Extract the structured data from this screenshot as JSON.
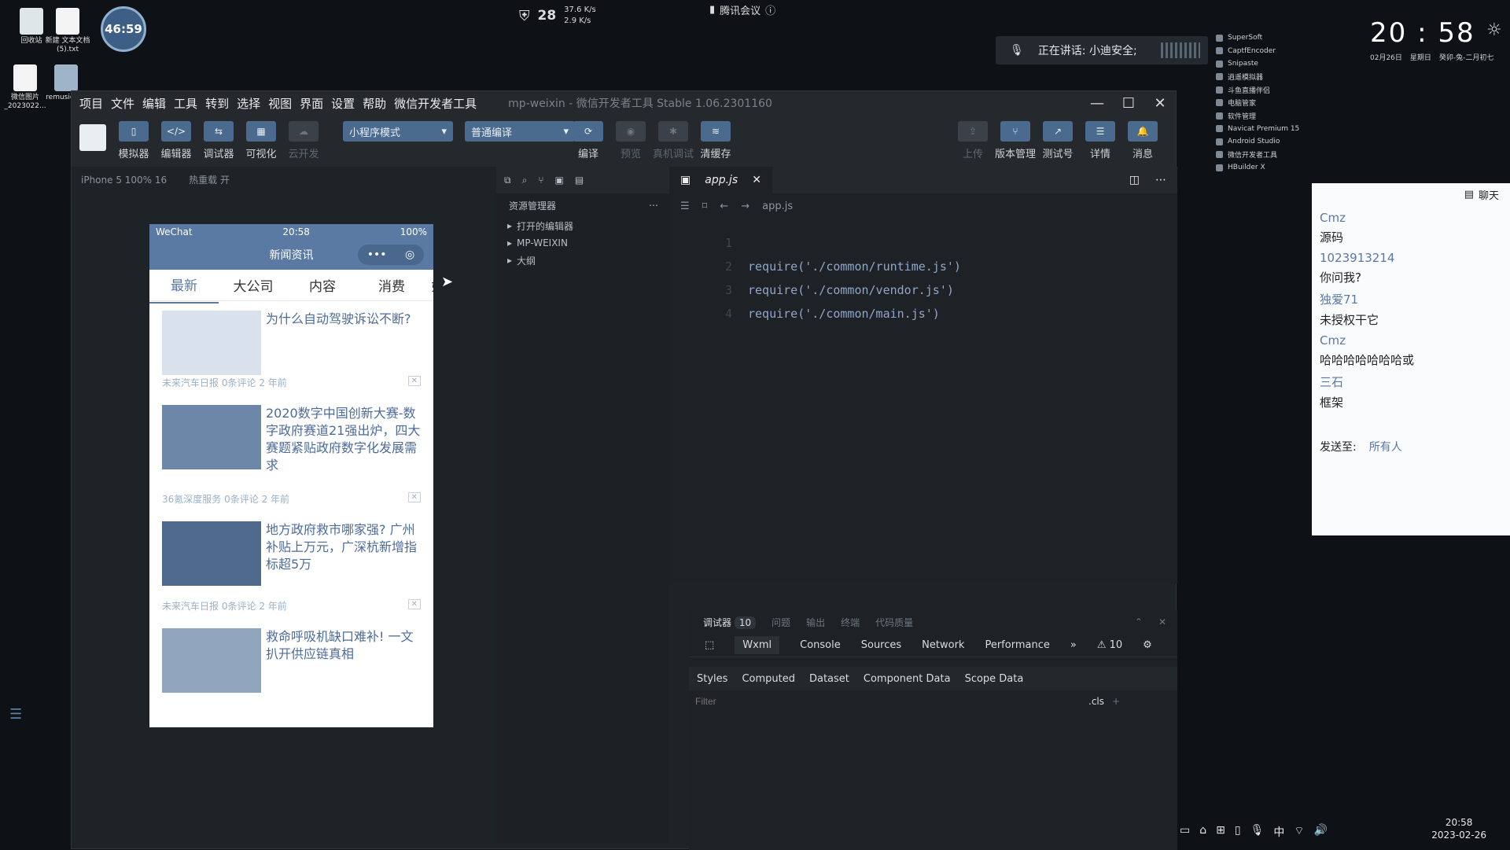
{
  "desktop": {
    "icons": [
      {
        "label": "回收站"
      },
      {
        "label": "新建 文本文档 (5).txt"
      },
      {
        "label": "微信图片_2023022..."
      },
      {
        "label": "remusic-ter"
      }
    ],
    "timer": "46:59",
    "security_score": "28",
    "net_up": "37.6 K/s",
    "net_down": "2.9 K/s",
    "meeting_app": "腾讯会议",
    "speaking": "正在讲话: 小迪安全;"
  },
  "widget": {
    "apps": [
      "SuperSoft",
      "CaptfEncoder",
      "Snipaste",
      "逍遥模拟器",
      "斗鱼直播伴侣",
      "电脑管家",
      "软件管理",
      "Navicat Premium 15",
      "Android Studio",
      "微信开发者工具",
      "HBuilder X"
    ],
    "clock": "20 : 58",
    "date": "02月26日",
    "weekday": "星期日",
    "lunar": "癸卯-兔-二月初七"
  },
  "chat": {
    "header": "聊天",
    "messages": [
      {
        "name": "Cmz",
        "text": "源码"
      },
      {
        "name": "1023913214",
        "text": "你问我?"
      },
      {
        "name": "独爱71",
        "text": "未授权干它"
      },
      {
        "name": "Cmz",
        "text": "哈哈哈哈哈哈哈或"
      },
      {
        "name": "三石",
        "text": "框架"
      }
    ],
    "send_to_label": "发送至:",
    "send_to_value": "所有人"
  },
  "ide": {
    "menu": [
      "项目",
      "文件",
      "编辑",
      "工具",
      "转到",
      "选择",
      "视图",
      "界面",
      "设置",
      "帮助",
      "微信开发者工具"
    ],
    "title": "mp-weixin - 微信开发者工具 Stable 1.06.2301160",
    "toolbar": {
      "simulator": "模拟器",
      "editor": "编辑器",
      "debugger": "调试器",
      "visual": "可视化",
      "cloud": "云开发",
      "mode": "小程序模式",
      "compile_mode": "普通编译",
      "compile": "编译",
      "preview": "预览",
      "real_debug": "真机调试",
      "clear_cache": "清缓存",
      "upload": "上传",
      "version": "版本管理",
      "test": "测试号",
      "details": "详情",
      "messages": "消息"
    },
    "device": "iPhone 5 100% 16",
    "hot_reload": "热重载 开",
    "phone": {
      "carrier": "WeChat",
      "time": "20:58",
      "battery": "100%",
      "nav_title": "新闻资讯",
      "tabs": [
        "最新",
        "大公司",
        "内容",
        "消费",
        "娱"
      ],
      "news": [
        {
          "title": "为什么自动驾驶诉讼不断?",
          "source": "未来汽车日报",
          "comments": "0条评论",
          "time": "2 年前"
        },
        {
          "title": "2020数字中国创新大赛-数字政府赛道21强出炉，四大赛题紧贴政府数字化发展需求",
          "source": "36氪深度服务",
          "comments": "0条评论",
          "time": "2 年前"
        },
        {
          "title": "地方政府救市哪家强? 广州补贴上万元，广深杭新增指标超5万",
          "source": "未来汽车日报",
          "comments": "0条评论",
          "time": "2 年前"
        },
        {
          "title": "救命呼吸机缺口难补! 一文扒开供应链真相",
          "source": "",
          "comments": "",
          "time": ""
        }
      ]
    },
    "explorer": {
      "title": "资源管理器",
      "sections": [
        "打开的编辑器",
        "MP-WEIXIN",
        "大纲"
      ]
    },
    "editor": {
      "tab": "app.js",
      "breadcrumb": "app.js",
      "lines": [
        {
          "n": "1",
          "code": ""
        },
        {
          "n": "2",
          "code": "require('./common/runtime.js')"
        },
        {
          "n": "3",
          "code": "require('./common/vendor.js')"
        },
        {
          "n": "4",
          "code": "require('./common/main.js')"
        }
      ]
    },
    "debug": {
      "top_tabs": [
        "调试器",
        "问题",
        "输出",
        "终端",
        "代码质量"
      ],
      "debugger_count": "10",
      "tabs": [
        "Wxml",
        "Console",
        "Sources",
        "Network",
        "Performance"
      ],
      "warn_count": "10",
      "style_tabs": [
        "Styles",
        "Computed",
        "Dataset",
        "Component Data",
        "Scope Data"
      ],
      "filter_placeholder": "Filter",
      "cls": ".cls"
    }
  },
  "taskbar": {
    "ime": "中",
    "time": "20:58",
    "date": "2023-02-26"
  }
}
